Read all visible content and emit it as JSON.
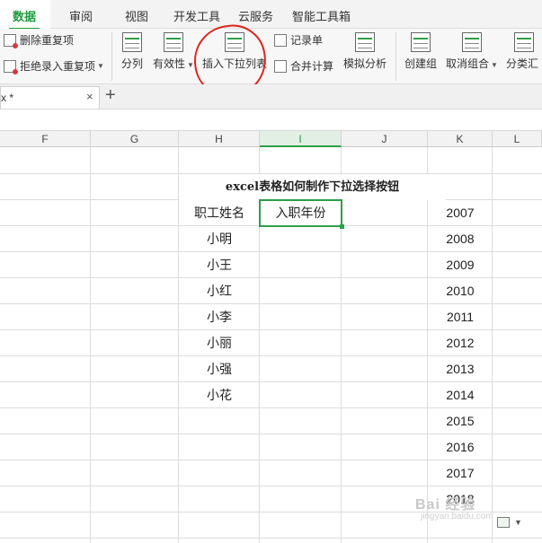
{
  "menu": {
    "tabs": [
      {
        "label": "数据",
        "active": true
      },
      {
        "label": "审阅"
      },
      {
        "label": "视图"
      },
      {
        "label": "开发工具"
      },
      {
        "label": "云服务"
      },
      {
        "label": "智能工具箱"
      }
    ]
  },
  "ribbon": {
    "remove_duplicates": "删除重复项",
    "reject_duplicates": "拒绝录入重复项",
    "split_column": "分列",
    "validity": "有效性",
    "insert_dropdown": "插入下拉列表",
    "record_form": "记录单",
    "merge_calc": "合并计算",
    "simulate": "模拟分析",
    "create_group": "创建组",
    "ungroup": "取消组合",
    "subtotal": "分类汇"
  },
  "doc_tab": {
    "name": "x *",
    "close": "×",
    "new": "+"
  },
  "columns": [
    "F",
    "G",
    "H",
    "I",
    "J",
    "K",
    "L"
  ],
  "sheet": {
    "title": "excel表格如何制作下拉选择按钮",
    "header_name": "职工姓名",
    "header_year": "入职年份",
    "names": [
      "小明",
      "小王",
      "小红",
      "小李",
      "小丽",
      "小强",
      "小花"
    ],
    "years": [
      "2007",
      "2008",
      "2009",
      "2010",
      "2011",
      "2012",
      "2013",
      "2014",
      "2015",
      "2016",
      "2017",
      "2018"
    ]
  },
  "watermark": {
    "text": "Bai 经验",
    "sub": "jingyan.baidu.com"
  },
  "colors": {
    "accent": "#1e9b3c",
    "annotation": "#e0221c"
  }
}
